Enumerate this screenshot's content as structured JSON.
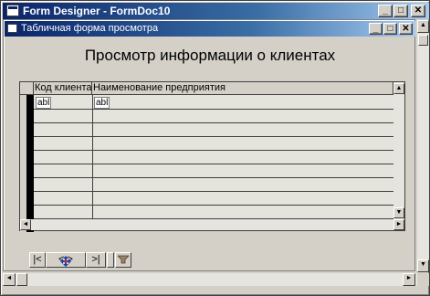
{
  "outer_window": {
    "title": "Form Designer - FormDoc10",
    "controls": {
      "minimize": "_",
      "maximize": "□",
      "close": "✕"
    }
  },
  "inner_window": {
    "title": "Табличная форма просмотра",
    "controls": {
      "minimize": "_",
      "maximize": "□",
      "close": "✕"
    }
  },
  "form": {
    "heading": "Просмотр информации о клиентах",
    "columns": [
      "Код клиента",
      "Наименование предприятия"
    ],
    "row_cells": [
      "abl",
      "abl"
    ]
  },
  "scrollbars": {
    "up": "▲",
    "down": "▼",
    "left": "◄",
    "right": "►"
  },
  "navigator": {
    "first": "|<",
    "prev_next": "< >",
    "last": ">|",
    "icons": [
      "move-cursor-icon",
      "filter-icon"
    ]
  },
  "colors": {
    "window_bg": "#d4d0c8",
    "titlebar_start": "#0a246a",
    "titlebar_end": "#a6caf0",
    "grid_bg": "#e4e3dc"
  }
}
